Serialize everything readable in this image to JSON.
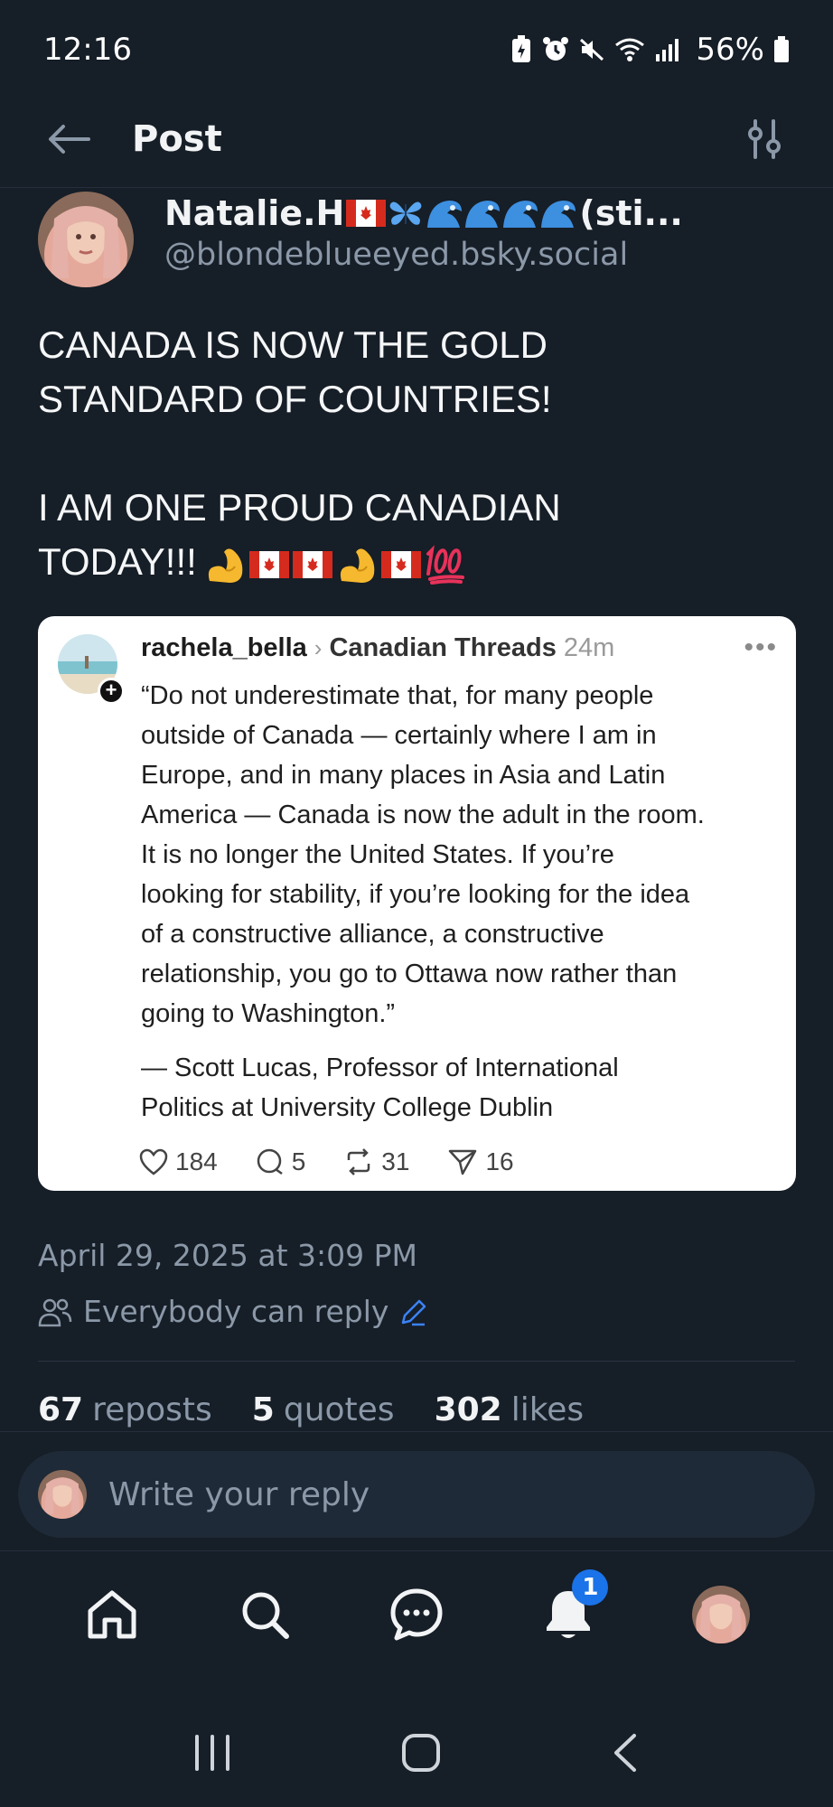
{
  "status_bar": {
    "time": "12:16",
    "battery": "56%"
  },
  "header": {
    "title": "Post"
  },
  "author": {
    "display_name_start": "Natalie.H",
    "display_name_end": "(sti...",
    "handle": "@blondeblueeyed.bsky.social"
  },
  "post": {
    "line1": "CANADA IS NOW THE GOLD",
    "line2": "STANDARD OF COUNTRIES!",
    "line3": "I AM ONE PROUD CANADIAN",
    "line4": "TODAY!!!"
  },
  "embed": {
    "user": "rachela_bella",
    "community": "Canadian Threads",
    "time": "24m",
    "quote_lines": [
      "“Do not underestimate that, for many people",
      "outside of Canada — certainly where I am in",
      "Europe, and in many places in Asia and Latin",
      "America — Canada is now the adult in the room.",
      "It is no longer the United States. If you’re",
      "looking for stability, if you’re looking for the idea",
      "of a constructive alliance, a constructive",
      "relationship, you go to Ottawa now rather than",
      "going to Washington.”"
    ],
    "attribution_lines": [
      "— Scott Lucas, Professor of International",
      "Politics at University College Dublin"
    ],
    "likes": "184",
    "comments": "5",
    "reposts": "31",
    "shares": "16"
  },
  "meta": {
    "timestamp": "April 29, 2025 at 3:09 PM",
    "reply_setting": "Everybody can reply"
  },
  "stats": {
    "reposts_count": "67",
    "reposts_label": "reposts",
    "quotes_count": "5",
    "quotes_label": "quotes",
    "likes_count": "302",
    "likes_label": "likes"
  },
  "composer": {
    "placeholder": "Write your reply"
  },
  "nav": {
    "notifications_badge": "1"
  },
  "colors": {
    "background": "#161e27",
    "accent": "#1a73e8",
    "muted": "#8b98a8"
  }
}
